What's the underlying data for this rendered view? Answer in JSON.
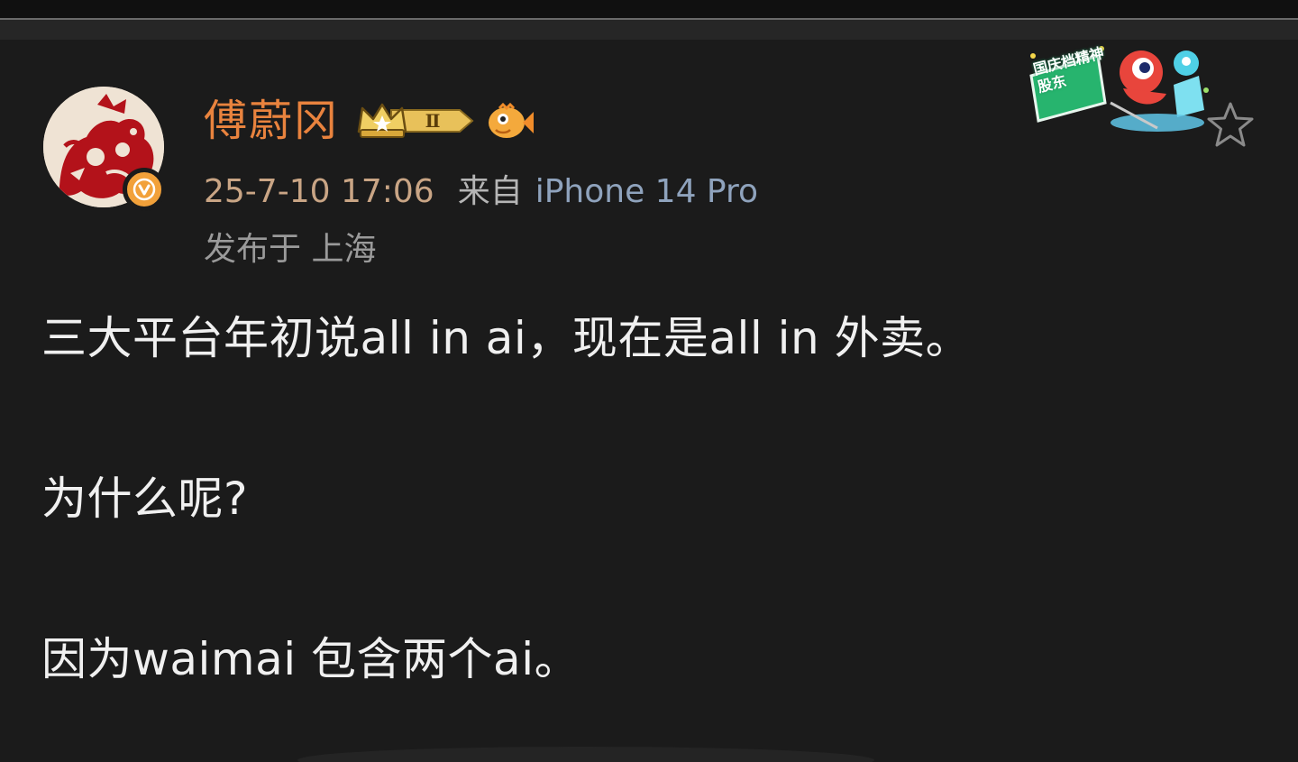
{
  "post": {
    "author": {
      "name": "傅蔚冈",
      "badge_level": "Ⅱ"
    },
    "meta": {
      "time": "25-7-10 17:06",
      "source_prefix": "来自",
      "device": "iPhone 14 Pro",
      "location": "发布于 上海"
    },
    "sticker": {
      "text": "国庆档精神股东"
    },
    "body": [
      "三大平台年初说all in ai，现在是all in 外卖。",
      "为什么呢?",
      "因为waimai 包含两个ai。"
    ]
  },
  "icons": {
    "verified": "verified-v-icon",
    "level": "crown-level-icon",
    "fish": "fish-emoji-icon",
    "star": "star-outline-icon"
  },
  "colors": {
    "background": "#1b1b1b",
    "name": "#e9833e",
    "time": "#c9a585",
    "device": "#8fa3bd",
    "body_text": "#f0f0f0",
    "verified": "#f2a13a"
  }
}
